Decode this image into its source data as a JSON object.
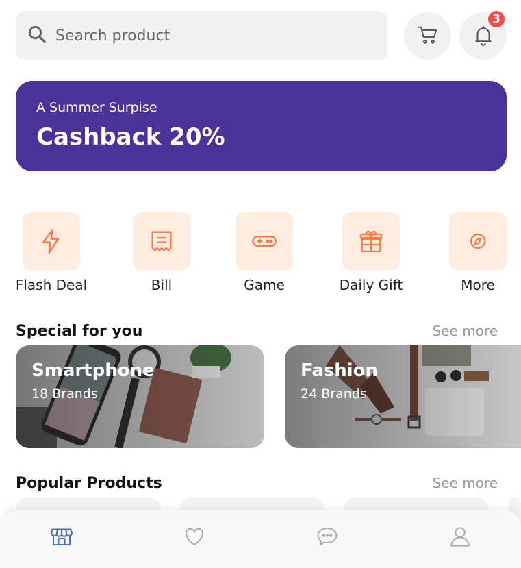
{
  "search": {
    "placeholder": "Search product",
    "icon": "search-icon"
  },
  "header": {
    "cart_icon": "cart-icon",
    "bell_icon": "bell-icon",
    "notification_count": "3"
  },
  "banner": {
    "subtitle": "A Summer Surpise",
    "headline": "Cashback 20%",
    "color": "#4a3298"
  },
  "categories": [
    {
      "label": "Flash Deal",
      "icon": "flash-icon"
    },
    {
      "label": "Bill",
      "icon": "bill-icon"
    },
    {
      "label": "Game",
      "icon": "gamepad-icon"
    },
    {
      "label": "Daily Gift",
      "icon": "gift-icon"
    },
    {
      "label": "More",
      "icon": "discover-icon"
    }
  ],
  "special": {
    "title": "Special for you",
    "see_more": "See more",
    "cards": [
      {
        "title": "Smartphone",
        "count": "18 Brands"
      },
      {
        "title": "Fashion",
        "count": "24 Brands"
      }
    ]
  },
  "popular": {
    "title": "Popular Products",
    "see_more": "See more"
  },
  "bottom_nav": [
    {
      "icon": "shop-icon",
      "active": true
    },
    {
      "icon": "heart-icon",
      "active": false
    },
    {
      "icon": "chat-icon",
      "active": false
    },
    {
      "icon": "user-icon",
      "active": false
    }
  ],
  "colors": {
    "accent": "#4a3298",
    "icon_tile": "#ffece0",
    "icon_stroke": "#ff7643",
    "badge": "#ff4848"
  }
}
